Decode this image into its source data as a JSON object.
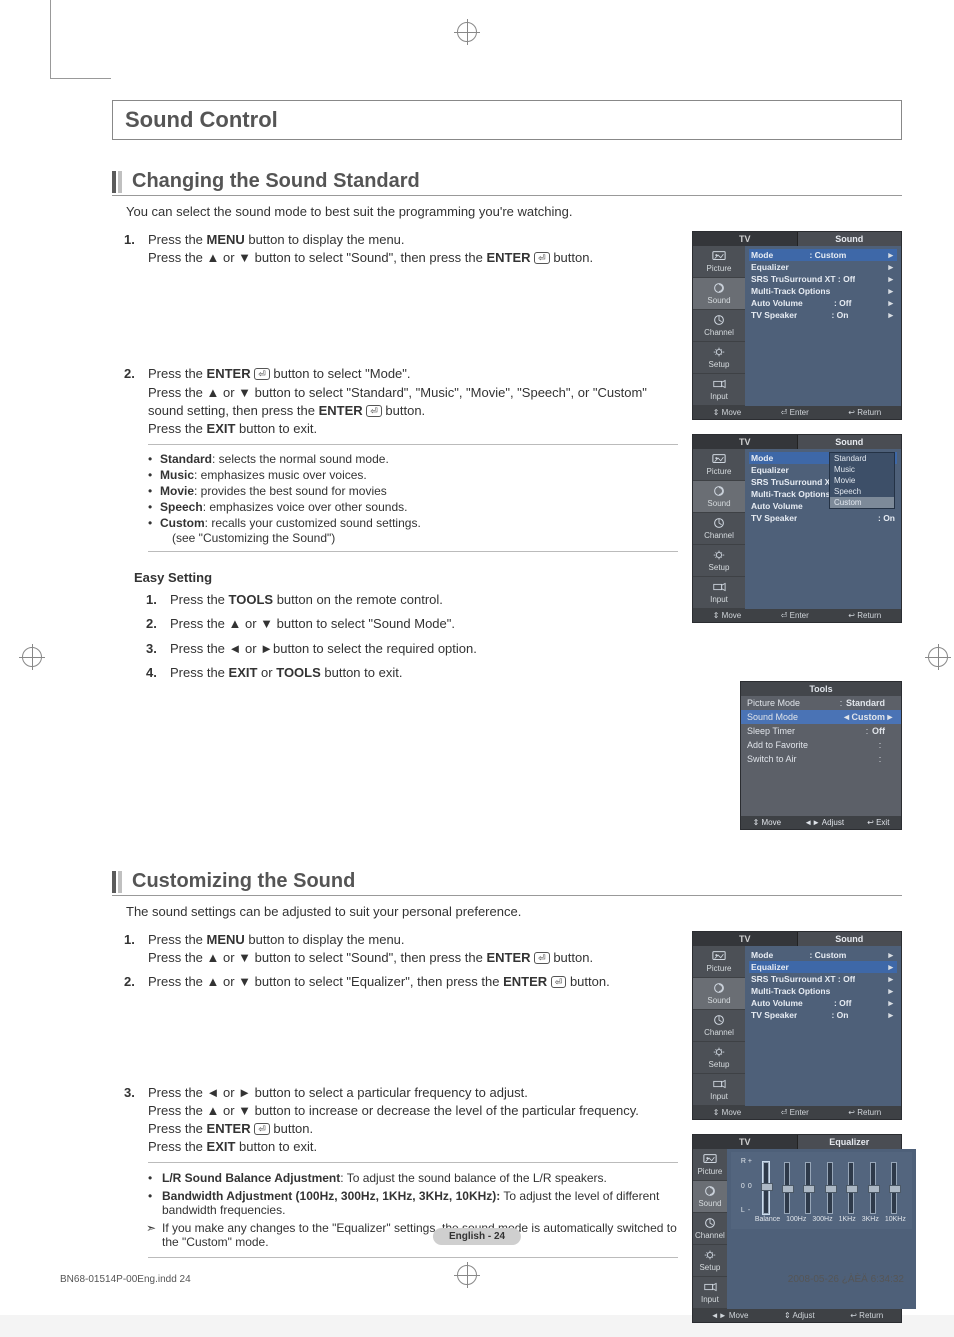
{
  "glyphs": {
    "up": "▲",
    "down": "▼",
    "left": "◄",
    "right": "►",
    "enter": "⏎",
    "updown": "⇕",
    "lr": "◄►",
    "ret": "↩"
  },
  "h1": "Sound Control",
  "sections": [
    {
      "title": "Changing the Sound Standard",
      "intro": "You can select the sound mode to best suit the programming you're watching.",
      "steps": [
        {
          "n": "1.",
          "lines": [
            "Press the <b>MENU</b> button to display the menu.",
            "Press the ▲ or ▼ button to select \"Sound\", then press the <b>ENTER</b> <e></e> button."
          ]
        },
        {
          "n": "2.",
          "lines": [
            "Press the <b>ENTER</b> <e></e> button to select \"Mode\".",
            "Press the ▲ or ▼ button to select \"Standard\", \"Music\", \"Movie\", \"Speech\", or \"Custom\" sound setting, then press the <b>ENTER</b> <e></e> button.",
            "Press the <b>EXIT</b> button to exit."
          ]
        }
      ],
      "bullets": [
        "<b>Standard</b>: selects the normal sound mode.",
        "<b>Music</b>: emphasizes music over voices.",
        "<b>Movie</b>: provides the best sound for movies",
        "<b>Speech</b>: emphasizes voice over other sounds.",
        "<b>Custom</b>: recalls your customized sound settings."
      ],
      "bullets_note": "(see \"Customizing the Sound\")",
      "easy_title": "Easy Setting",
      "easy_steps": [
        {
          "n": "1.",
          "html": "Press the <b>TOOLS</b> button on the remote control."
        },
        {
          "n": "2.",
          "html": "Press the ▲ or ▼ button to select \"Sound Mode\"."
        },
        {
          "n": "3.",
          "html": "Press the ◄ or ►button to select the required option."
        },
        {
          "n": "4.",
          "html": "Press the <b>EXIT</b> or <b>TOOLS</b> button to exit."
        }
      ]
    },
    {
      "title": "Customizing the Sound",
      "intro": "The sound settings can be adjusted to suit your personal preference.",
      "steps": [
        {
          "n": "1.",
          "lines": [
            "Press the <b>MENU</b> button to display the menu.",
            "Press the ▲ or ▼ button to select \"Sound\", then press the <b>ENTER</b> <e></e> button."
          ]
        },
        {
          "n": "2.",
          "lines": [
            "Press the ▲ or ▼ button to select \"Equalizer\", then press the <b>ENTER</b> <e></e> button."
          ]
        },
        {
          "n": "3.",
          "lines": [
            "Press the ◄ or ► button to select a particular frequency to adjust.",
            "Press the ▲ or ▼ button to increase or decrease the level of the particular frequency.",
            "Press the <b>ENTER</b> <e></e> button.",
            "Press the <b>EXIT</b> button to exit."
          ]
        }
      ],
      "notes": [
        {
          "t": "b",
          "html": "<b>L/R Sound Balance Adjustment</b>: To adjust the sound balance of the L/R speakers."
        },
        {
          "t": "b",
          "html": "<b>Bandwidth Adjustment (100Hz, 300Hz, 1KHz, 3KHz, 10KHz):</b> To adjust the level of different bandwidth frequencies."
        },
        {
          "t": "n",
          "html": "If you make any changes to the \"Equalizer\" settings, the sound mode is automatically switched to the \"Custom\" mode."
        }
      ]
    }
  ],
  "osd_sound": {
    "tabL": "TV",
    "tabR": "Sound",
    "nav": [
      "Picture",
      "Sound",
      "Channel",
      "Setup",
      "Input"
    ],
    "nav_sel": 1,
    "items": [
      {
        "label": "Mode",
        "val": ": Custom",
        "sel": true,
        "arrow": true
      },
      {
        "label": "Equalizer",
        "val": "",
        "arrow": true
      },
      {
        "label": "SRS TruSurround XT : Off",
        "val": "",
        "arrow": true
      },
      {
        "label": "Multi-Track Options",
        "val": "",
        "arrow": true
      },
      {
        "label": "Auto Volume",
        "val": ": Off",
        "arrow": true
      },
      {
        "label": "TV Speaker",
        "val": ": On",
        "arrow": true
      }
    ],
    "foot": [
      "⇕ Move",
      "⏎ Enter",
      "↩ Return"
    ]
  },
  "osd_mode": {
    "tabL": "TV",
    "tabR": "Sound",
    "nav": [
      "Picture",
      "Sound",
      "Channel",
      "Setup",
      "Input"
    ],
    "nav_sel": 1,
    "items": [
      {
        "label": "Mode",
        "val": ":",
        "sel": true
      },
      {
        "label": "Equalizer",
        "val": ":"
      },
      {
        "label": "SRS TruSurround XT",
        "val": ":"
      },
      {
        "label": "Multi-Track Options",
        "val": ""
      },
      {
        "label": "Auto Volume",
        "val": ":"
      },
      {
        "label": "TV Speaker",
        "val": ": On"
      }
    ],
    "options": [
      "Standard",
      "Music",
      "Movie",
      "Speech",
      "Custom"
    ],
    "options_sel": 4,
    "foot": [
      "⇕ Move",
      "⏎ Enter",
      "↩ Return"
    ]
  },
  "tools": {
    "title": "Tools",
    "rows": [
      {
        "label": "Picture Mode",
        "val": "Standard"
      },
      {
        "label": "Sound Mode",
        "val": "Custom",
        "sel": true,
        "lr": true
      },
      {
        "label": "Sleep Timer",
        "val": "Off"
      },
      {
        "label": "Add to Favorite",
        "val": ""
      },
      {
        "label": "Switch to Air",
        "val": ""
      }
    ],
    "foot": [
      "⇕ Move",
      "◄► Adjust",
      "↩ Exit"
    ]
  },
  "osd_sound2": {
    "tabL": "TV",
    "tabR": "Sound",
    "nav": [
      "Picture",
      "Sound",
      "Channel",
      "Setup",
      "Input"
    ],
    "nav_sel": 1,
    "items": [
      {
        "label": "Mode",
        "val": ": Custom",
        "arrow": true
      },
      {
        "label": "Equalizer",
        "val": "",
        "sel": true,
        "arrow": true
      },
      {
        "label": "SRS TruSurround XT : Off",
        "val": "",
        "arrow": true
      },
      {
        "label": "Multi-Track Options",
        "val": "",
        "arrow": true
      },
      {
        "label": "Auto Volume",
        "val": ": Off",
        "arrow": true
      },
      {
        "label": "TV Speaker",
        "val": ": On",
        "arrow": true
      }
    ],
    "foot": [
      "⇕ Move",
      "⏎ Enter",
      "↩ Return"
    ]
  },
  "osd_eq": {
    "tabL": "TV",
    "tabR": "Equalizer",
    "nav": [
      "Picture",
      "Sound",
      "Channel",
      "Setup",
      "Input"
    ],
    "nav_sel": 1,
    "lr_top": "R",
    "lr_bot": "L",
    "plus": "+",
    "zero": "0",
    "minus": "-",
    "bands": [
      "Balance",
      "100Hz",
      "300Hz",
      "1KHz",
      "3KHz",
      "10KHz"
    ],
    "thumbs": [
      0.55,
      0.5,
      0.5,
      0.5,
      0.5,
      0.5,
      0.5
    ],
    "foot": [
      "◄► Move",
      "⇕ Adjust",
      "↩ Return"
    ]
  },
  "page_num": "English - 24",
  "footer": {
    "left": "BN68-01514P-00Eng.indd   24",
    "right": "2008-05-26   ¿ÀÈÄ 6:34:32"
  }
}
